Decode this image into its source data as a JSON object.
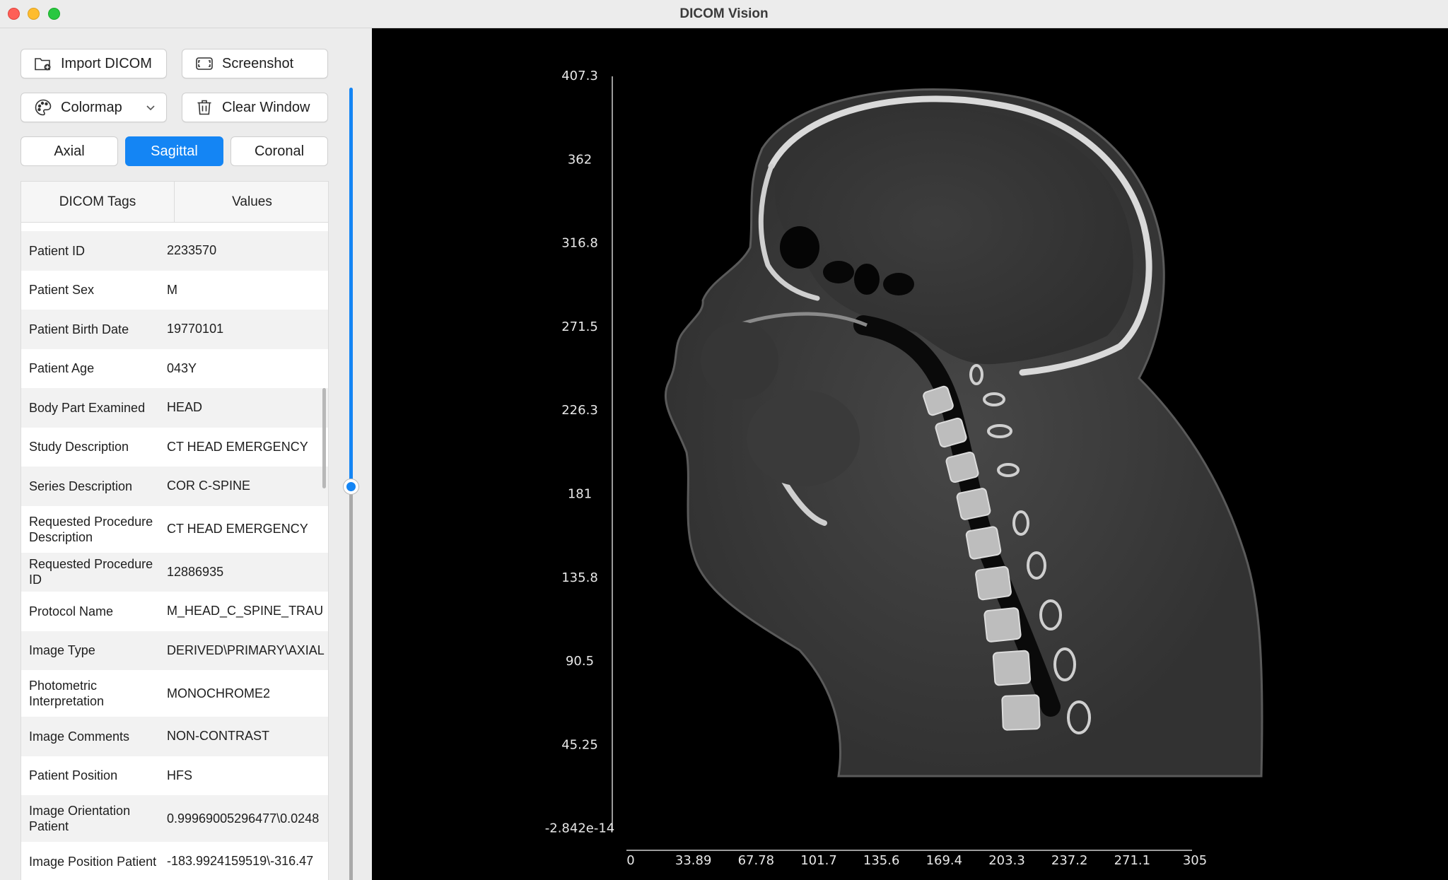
{
  "window": {
    "title": "DICOM Vision"
  },
  "toolbar": {
    "import_label": "Import DICOM",
    "screenshot_label": "Screenshot",
    "colormap_label": "Colormap",
    "clear_label": "Clear Window"
  },
  "views": {
    "axial": "Axial",
    "sagittal": "Sagittal",
    "coronal": "Coronal",
    "selected": "Sagittal"
  },
  "table": {
    "header_tags": "DICOM Tags",
    "header_values": "Values",
    "rows": [
      {
        "tag": "Patient ID",
        "value": "2233570"
      },
      {
        "tag": "Patient Sex",
        "value": "M"
      },
      {
        "tag": "Patient Birth Date",
        "value": "19770101"
      },
      {
        "tag": "Patient Age",
        "value": "043Y"
      },
      {
        "tag": "Body Part Examined",
        "value": "HEAD"
      },
      {
        "tag": "Study Description",
        "value": "CT  HEAD EMERGENCY"
      },
      {
        "tag": "Series Description",
        "value": "COR C-SPINE"
      },
      {
        "tag": "Requested Procedure Description",
        "value": "CT  HEAD EMERGENCY"
      },
      {
        "tag": "Requested Procedure ID",
        "value": "12886935"
      },
      {
        "tag": "Protocol Name",
        "value": "M_HEAD_C_SPINE_TRAU"
      },
      {
        "tag": "Image Type",
        "value": "DERIVED\\PRIMARY\\AXIAL"
      },
      {
        "tag": "Photometric Interpretation",
        "value": "MONOCHROME2"
      },
      {
        "tag": "Image Comments",
        "value": "NON-CONTRAST"
      },
      {
        "tag": "Patient Position",
        "value": "HFS"
      },
      {
        "tag": "Image Orientation Patient",
        "value": "0.99969005296477\\0.0248"
      },
      {
        "tag": "Image Position Patient",
        "value": "-183.9924159519\\-316.47"
      }
    ]
  },
  "slice_slider": {
    "position_fraction": 0.5
  },
  "viewer": {
    "y_ticks": [
      "407.3",
      "362",
      "316.8",
      "271.5",
      "226.3",
      "181",
      "135.8",
      "90.5",
      "45.25",
      "-2.842e-14"
    ],
    "x_ticks": [
      "0",
      "33.89",
      "67.78",
      "101.7",
      "135.6",
      "169.4",
      "203.3",
      "237.2",
      "271.1",
      "305"
    ],
    "y_range": [
      0,
      407.3
    ],
    "x_range": [
      0,
      305
    ]
  },
  "colors": {
    "accent": "#1485f4",
    "background": "#ececec",
    "viewer_bg": "#000000"
  }
}
